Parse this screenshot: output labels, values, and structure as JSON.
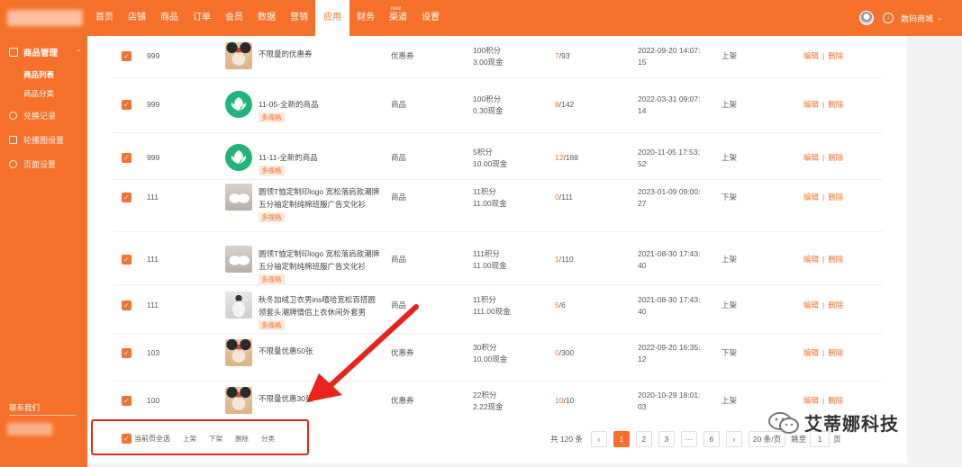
{
  "topnav": {
    "items": [
      "首页",
      "店铺",
      "商品",
      "订单",
      "会员",
      "数据",
      "营销",
      "应用",
      "财务",
      "渠道",
      "设置"
    ],
    "active_index": 7,
    "badge": "new",
    "store_name": "数码商城"
  },
  "sidebar": {
    "section": "商品管理",
    "sub_items": [
      "商品列表",
      "商品分类"
    ],
    "items": [
      "兑换记录",
      "轮播图设置",
      "页面设置"
    ],
    "contact": "联系我们"
  },
  "rows": [
    {
      "id": "999",
      "name": "不限量的优惠券",
      "tag": "",
      "img": "dog",
      "type": "优惠券",
      "points": "100积分",
      "cash": "3.00现金",
      "sold": "7",
      "total": "/93",
      "time1": "2022-09-20 14:07:",
      "time2": "15",
      "status": "上架"
    },
    {
      "id": "999",
      "name": "11-05-全新的商品",
      "tag": "多规格",
      "img": "leaf",
      "type": "商品",
      "points": "100积分",
      "cash": "0.30现金",
      "sold": "8",
      "total": "/142",
      "time1": "2022-03-31 09:07:",
      "time2": "14",
      "status": "上架"
    },
    {
      "id": "999",
      "name": "11-11-全新的商品",
      "tag": "多规格",
      "img": "leaf",
      "type": "商品",
      "points": "5积分",
      "cash": "10.00现金",
      "sold": "12",
      "total": "/188",
      "time1": "2020-11-05 17:53:",
      "time2": "52",
      "status": "上架"
    },
    {
      "id": "111",
      "name": "圆领T恤定制印logo 宽松落肩款潮牌五分袖定制纯棉班服广告文化衫",
      "tag": "多规格",
      "img": "shirt",
      "type": "商品",
      "points": "11积分",
      "cash": "11.00现金",
      "sold": "0",
      "total": "/111",
      "time1": "2023-01-09 09:00:",
      "time2": "27",
      "status": "下架"
    },
    {
      "id": "111",
      "name": "圆领T恤定制印logo 宽松落肩款潮牌五分袖定制纯棉班服广告文化衫",
      "tag": "多规格",
      "img": "shirt",
      "type": "商品",
      "points": "111积分",
      "cash": "11.00现金",
      "sold": "1",
      "total": "/110",
      "time1": "2021-08-30 17:43:",
      "time2": "40",
      "status": "上架"
    },
    {
      "id": "111",
      "name": "秋冬加绒卫衣男ins嘻哈宽松百搭圆领套头潮牌情侣上衣休闲外套男",
      "tag": "多规格",
      "img": "hoodie",
      "type": "商品",
      "points": "11积分",
      "cash": "111.00现金",
      "sold": "5",
      "total": "/6",
      "time1": "2021-08-30 17:43:",
      "time2": "40",
      "status": "上架"
    },
    {
      "id": "103",
      "name": "不限量优惠50张",
      "tag": "",
      "img": "dog",
      "type": "优惠券",
      "points": "30积分",
      "cash": "10.00现金",
      "sold": "0",
      "total": "/300",
      "time1": "2022-09-20 16:35:",
      "time2": "12",
      "status": "下架"
    },
    {
      "id": "100",
      "name": "不限量优惠30张",
      "tag": "",
      "img": "dog",
      "type": "优惠券",
      "points": "22积分",
      "cash": "2.22现金",
      "sold": "10",
      "total": "/10",
      "time1": "2020-10-29 18:01:",
      "time2": "03",
      "status": "上架"
    }
  ],
  "ops": {
    "edit": "编辑",
    "delete": "删除",
    "sep": "|"
  },
  "bulk": {
    "select_all": "当前页全选",
    "on_shelf": "上架",
    "off_shelf": "下架",
    "delete": "删除",
    "category": "分类"
  },
  "pagination": {
    "total": "共 120 条",
    "pages": [
      "1",
      "2",
      "3",
      "···",
      "6"
    ],
    "prev": "‹",
    "next": "›",
    "size": "20 条/页",
    "jump": "跳至",
    "page_unit": "页",
    "current": "1"
  },
  "watermark": "艾蒂娜科技",
  "colors": {
    "brand": "#f5712b",
    "highlight": "#e8241a"
  }
}
